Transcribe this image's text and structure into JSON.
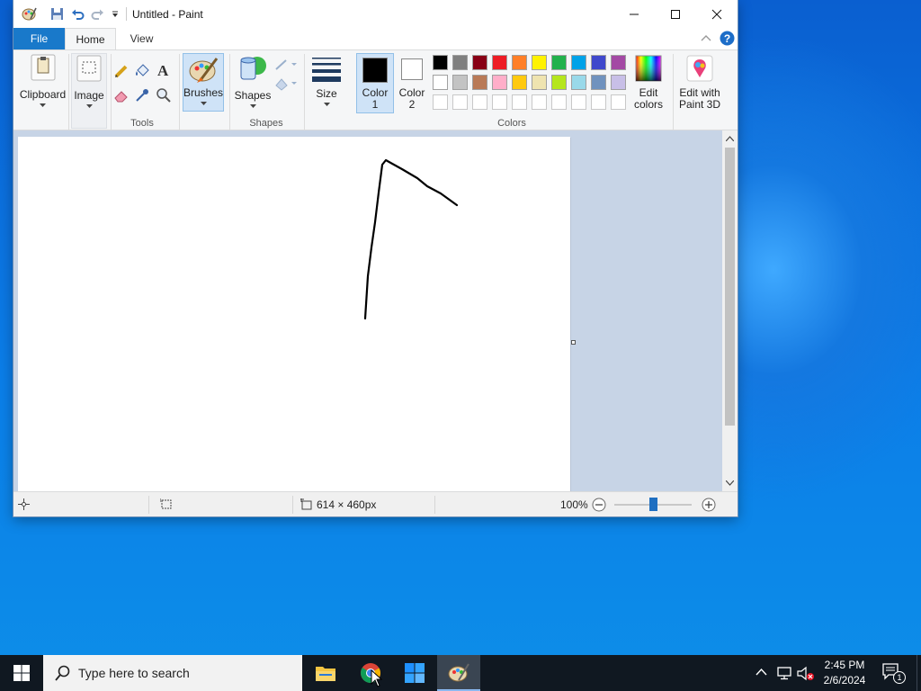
{
  "window": {
    "title": "Untitled - Paint",
    "controls": [
      "minimize",
      "maximize",
      "close"
    ]
  },
  "tabs": [
    {
      "label": "File",
      "active": false
    },
    {
      "label": "Home",
      "active": true
    },
    {
      "label": "View",
      "active": false
    }
  ],
  "ribbon": {
    "clipboard_label": "Clipboard",
    "image_label": "Image",
    "tools_label": "Tools",
    "brushes_label": "Brushes",
    "shapes_btn_label": "Shapes",
    "shapes_group_label": "Shapes",
    "size_label": "Size",
    "color1_label": "Color 1",
    "color1_line1": "Color",
    "color1_line2": "1",
    "color2_line1": "Color",
    "color2_line2": "2",
    "colors_group_label": "Colors",
    "edit_colors_line1": "Edit",
    "edit_colors_line2": "colors",
    "edit3d_line1": "Edit with",
    "edit3d_line2": "Paint 3D"
  },
  "palette": {
    "row1": [
      "#000000",
      "#7f7f7f",
      "#880015",
      "#ed1c24",
      "#ff7f27",
      "#fff200",
      "#22b14c",
      "#00a2e8",
      "#3f48cc",
      "#a349a4"
    ],
    "row2": [
      "#ffffff",
      "#c3c3c3",
      "#b97a57",
      "#ffaec9",
      "#ffc90e",
      "#efe4b0",
      "#b5e61d",
      "#99d9ea",
      "#7092be",
      "#c8bfe7"
    ],
    "color1": "#000000",
    "color2": "#ffffff"
  },
  "status": {
    "canvas_size": "614 × 460px",
    "zoom": "100%",
    "zoom_fraction": 0.5
  },
  "taskbar": {
    "search_placeholder": "Type here to search",
    "time": "2:45 PM",
    "date": "2/6/2024",
    "notification_count": "1"
  }
}
